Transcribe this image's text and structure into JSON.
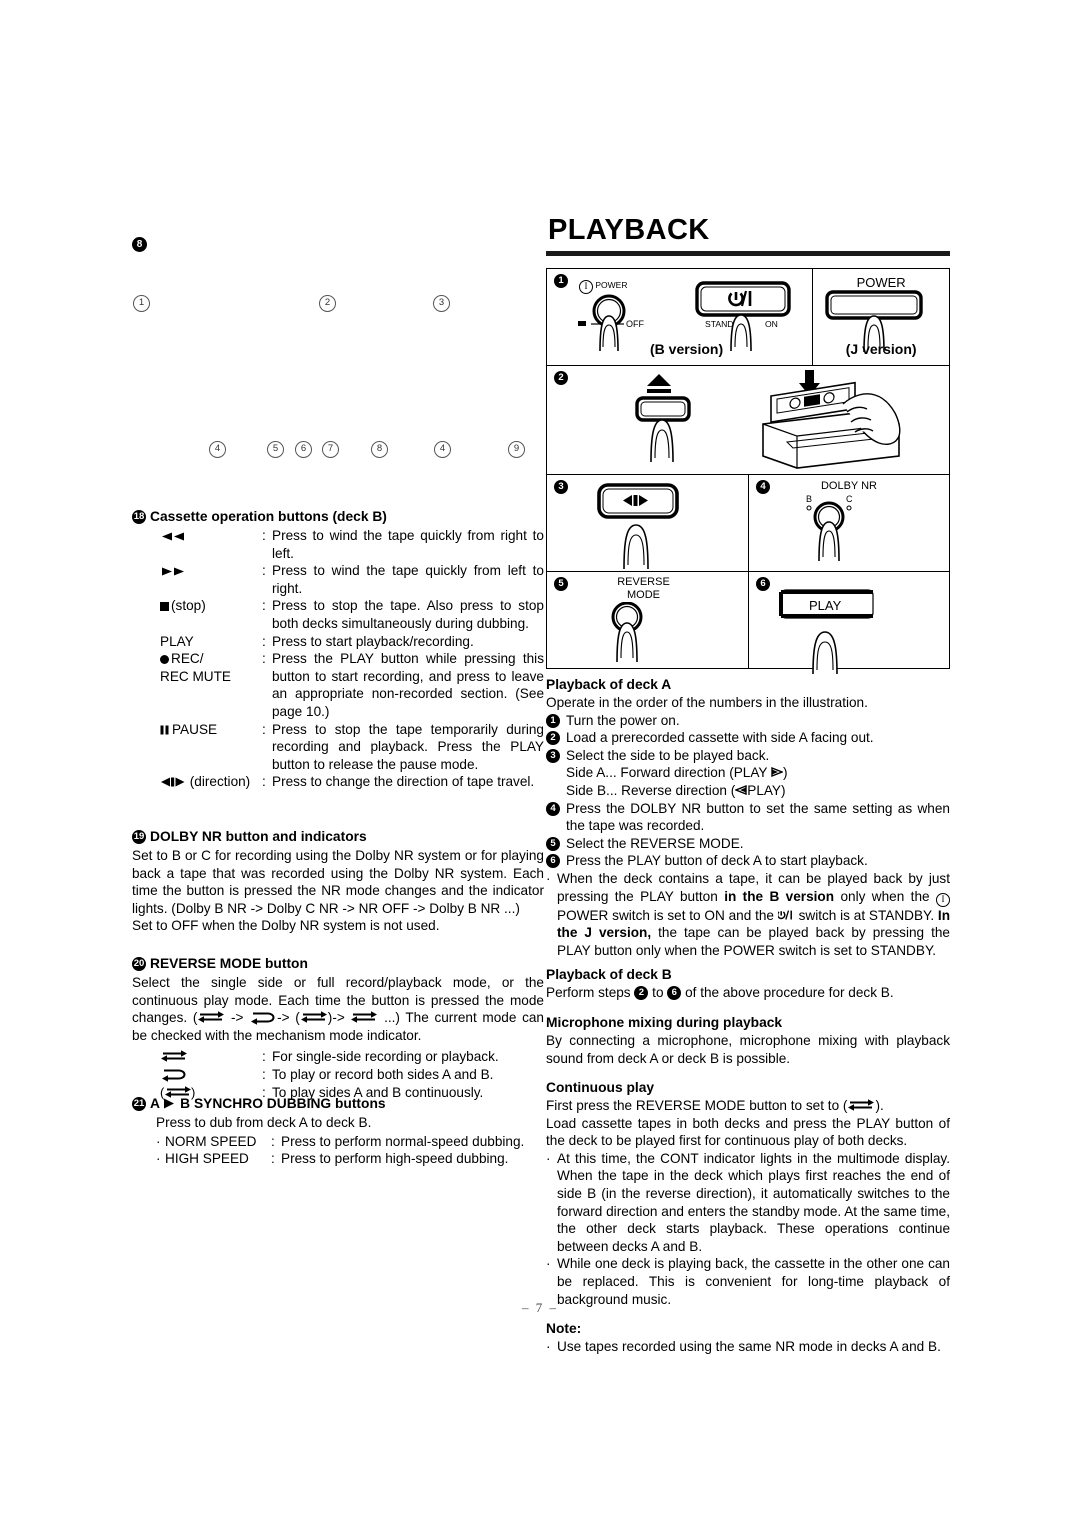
{
  "page": {
    "number": "– 7 –"
  },
  "left_column": {
    "callouts_top": [
      {
        "label": "8",
        "filled": true
      },
      {
        "label": "1"
      },
      {
        "label": "2"
      },
      {
        "label": "3"
      }
    ],
    "callouts_bottom": [
      "4",
      "5",
      "6",
      "7",
      "8",
      "4",
      "9"
    ],
    "items": [
      {
        "number": "18",
        "title": "Cassette operation buttons (deck B)",
        "rows": [
          {
            "symbol": "rewind-icon",
            "symbol_text": "◄◄",
            "desc": "Press to wind the tape quickly from right to left."
          },
          {
            "symbol": "fast-forward-icon",
            "symbol_text": "►►",
            "desc": "Press to wind the tape quickly from left to right."
          },
          {
            "symbol": "stop-icon",
            "symbol_text": "■ (stop)",
            "desc": "Press to stop the tape. Also press to stop both decks simultaneously during dubbing."
          },
          {
            "symbol": "play-label",
            "symbol_text": "PLAY",
            "desc": "Press to start playback/recording."
          },
          {
            "symbol": "rec-mute-label",
            "symbol_text": "●REC/ REC MUTE",
            "desc": "Press the PLAY button while pressing this button to start recording, and press to leave an appropriate non-recorded section. (See page 10.)"
          },
          {
            "symbol": "pause-icon",
            "symbol_text": "ⅡPAUSE",
            "desc": "Press to stop the tape temporarily during recording and playback. Press the PLAY button to release the pause mode."
          },
          {
            "symbol": "direction-icon",
            "symbol_text": "◄▮► (direction)",
            "desc": "Press to change the direction of tape travel."
          }
        ]
      },
      {
        "number": "19",
        "title": "DOLBY NR button and indicators",
        "paragraph1": "Set to B or C for recording using the Dolby NR system or for playing back a tape that was recorded using the Dolby NR system. Each time the button is pressed the NR mode changes and the indicator lights. (Dolby B NR -> Dolby C NR -> NR OFF -> Dolby B NR ...)",
        "paragraph2": "Set to OFF when the Dolby NR system is not used."
      },
      {
        "number": "20",
        "title": "REVERSE MODE button",
        "paragraph_a": "Select the single side or full record/playback mode, or the continuous play mode. Each time the button is pressed the mode changes. (",
        "paragraph_b": " -> ",
        "paragraph_c": "-> (",
        "paragraph_d": ")-> ",
        "paragraph_e": " ...) The current mode can be checked with the mechanism mode indicator.",
        "modes": [
          {
            "symbol": "single-side-icon",
            "desc": "For single-side recording or playback."
          },
          {
            "symbol": "both-sides-icon",
            "desc": "To play or record both sides A and B."
          },
          {
            "symbol": "continuous-icon",
            "desc": "To play sides A and B continuously."
          }
        ]
      },
      {
        "number": "21",
        "title_a": "A",
        "title_b": "B SYNCHRO DUBBING buttons",
        "lead": "Press to dub from deck A to deck B.",
        "rows": [
          {
            "label": "NORM SPEED",
            "desc": "Press to perform normal-speed dubbing."
          },
          {
            "label": "HIGH SPEED",
            "desc": "Press to perform high-speed dubbing."
          }
        ]
      }
    ]
  },
  "right_column": {
    "title": "PLAYBACK",
    "figure": {
      "step1": {
        "marker": "1",
        "power_switch_label": "POWER",
        "off_label": "OFF",
        "standby_label": "STANDBY",
        "on_label": "ON",
        "b_version_label": "(B version)",
        "j_power_label": "POWER",
        "j_version_label": "(J version)"
      },
      "step2": {
        "marker": "2"
      },
      "step3": {
        "marker": "3"
      },
      "step4": {
        "marker": "4",
        "dolby_label": "DOLBY NR",
        "b_label": "B",
        "c_label": "C"
      },
      "step5": {
        "marker": "5",
        "reverse_label": "REVERSE",
        "mode_label": "MODE"
      },
      "step6": {
        "marker": "6",
        "play_label": "PLAY"
      }
    },
    "deck_a": {
      "heading": "Playback of deck A",
      "intro": "Operate in the order of the numbers in the illustration.",
      "steps": [
        {
          "n": "1",
          "text": "Turn the power on."
        },
        {
          "n": "2",
          "text": "Load a prerecorded cassette with side A facing out."
        },
        {
          "n": "3",
          "text": "Select the side to be played back."
        },
        {
          "n": "4",
          "text": "Press the DOLBY NR button to set the same setting as when the tape was recorded."
        },
        {
          "n": "5",
          "text": "Select the REVERSE MODE."
        },
        {
          "n": "6",
          "text": "Press the PLAY button of deck A to start playback."
        }
      ],
      "side_a_line": "Side A... Forward direction (PLAY",
      "side_a_close": ")",
      "side_b_open": "Side B... Reverse direction (",
      "side_b_close": "PLAY)",
      "note_bullet": {
        "part1": "When the deck contains a tape, it can be played back by just pressing the PLAY button ",
        "bold1": "in the B version",
        "part2": " only when the ",
        "part3": "POWER switch is set to ON and the ",
        "part4": " switch is at STANDBY. ",
        "bold2": "In the J version,",
        "part5": " the tape can be played back by pressing the PLAY button only when the POWER switch is set to STANDBY."
      }
    },
    "deck_b": {
      "heading": "Playback of deck B",
      "text_a": "Perform steps",
      "step_from": "2",
      "text_b": "to",
      "step_to": "6",
      "text_c": "of the above procedure for deck B."
    },
    "mic_mixing": {
      "heading": "Microphone mixing during playback",
      "text": "By connecting a microphone, microphone mixing with playback sound from deck A or deck B is possible."
    },
    "continuous": {
      "heading": "Continuous play",
      "line1_a": "First press the REVERSE MODE button to set to (",
      "line1_b": ").",
      "line2": "Load cassette tapes in both decks and press the PLAY button of the deck to be played first for continuous play of both decks.",
      "bullets": [
        "At this time, the CONT indicator lights in the multimode display. When the tape in the deck which plays first reaches the end of side B (in the reverse direction), it automatically switches to the forward direction and enters the standby mode. At the same time, the other deck starts playback. These operations continue between decks A and B.",
        "While one deck is playing back, the cassette in the other one can be replaced. This is convenient for long-time playback of background music."
      ]
    },
    "note": {
      "heading": "Note:",
      "bullets": [
        "Use tapes recorded using the same NR mode in decks A and B."
      ]
    }
  }
}
